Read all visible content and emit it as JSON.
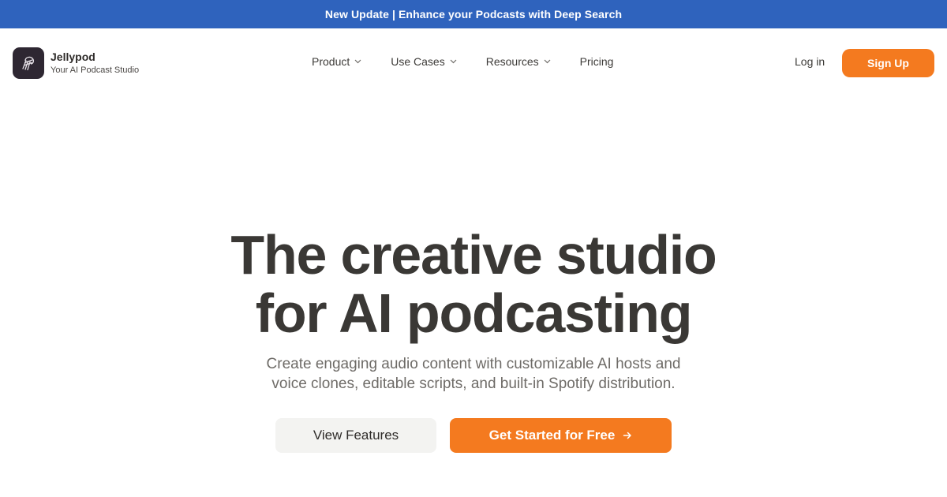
{
  "banner": {
    "text": "New Update | Enhance your Podcasts with Deep Search"
  },
  "brand": {
    "name": "Jellypod",
    "tagline": "Your AI Podcast Studio",
    "logo_icon": "jellyfish-logo-icon"
  },
  "nav": {
    "items": [
      {
        "label": "Product",
        "has_dropdown": true
      },
      {
        "label": "Use Cases",
        "has_dropdown": true
      },
      {
        "label": "Resources",
        "has_dropdown": true
      },
      {
        "label": "Pricing",
        "has_dropdown": false
      }
    ],
    "login_label": "Log in",
    "signup_label": "Sign Up"
  },
  "hero": {
    "title_line1": "The creative studio",
    "title_line2": "for AI podcasting",
    "subtitle_line1": "Create engaging audio content with customizable AI hosts and",
    "subtitle_line2": "voice clones, editable scripts, and built-in Spotify distribution.",
    "secondary_cta": "View Features",
    "primary_cta": "Get Started for Free"
  },
  "colors": {
    "banner_bg": "#2f63bd",
    "accent_orange": "#f47a1f",
    "heading_text": "#3a3835",
    "muted_text": "#6e6b67",
    "secondary_button_bg": "#f3f3f1",
    "logo_bg": "#2e2732"
  }
}
